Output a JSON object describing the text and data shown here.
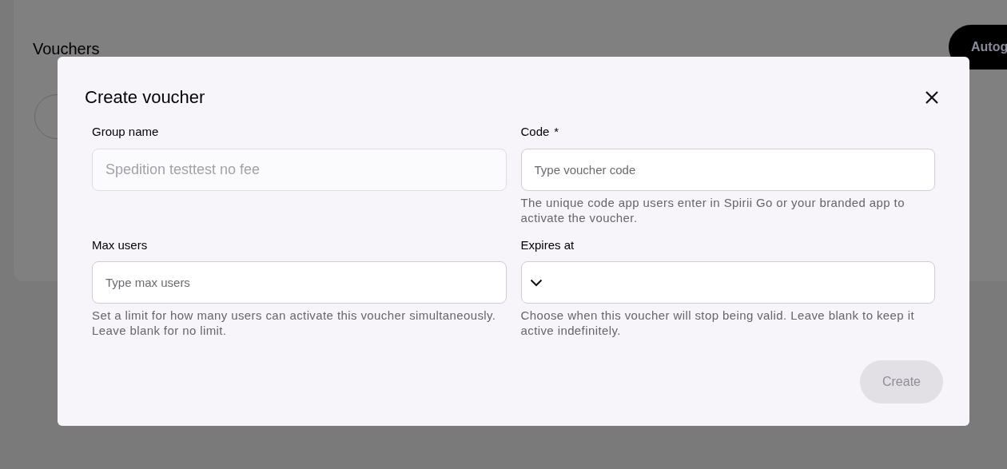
{
  "page": {
    "title": "Vouchers",
    "action_button": "Autog"
  },
  "dialog": {
    "title": "Create voucher",
    "fields": [
      {
        "kind": "text",
        "label": "Group name",
        "value": "Spedition testtest no fee",
        "disabled": true
      },
      {
        "kind": "text",
        "label": "Code",
        "required_mark": "*",
        "placeholder": "Type voucher code",
        "disabled": false,
        "help": "The unique code app users enter in Spirii Go or your branded app to activate the voucher."
      },
      {
        "kind": "text",
        "label": "Max users",
        "placeholder": "Type max users",
        "disabled": false,
        "help": "Set a limit for how many users can activate this voucher simultaneously. Leave blank for no limit."
      },
      {
        "kind": "select",
        "label": "Expires at",
        "disabled": false,
        "help": "Choose when this voucher will stop being valid. Leave blank to keep it active indefinitely."
      }
    ],
    "submit": {
      "label": "Create",
      "disabled": true
    }
  }
}
